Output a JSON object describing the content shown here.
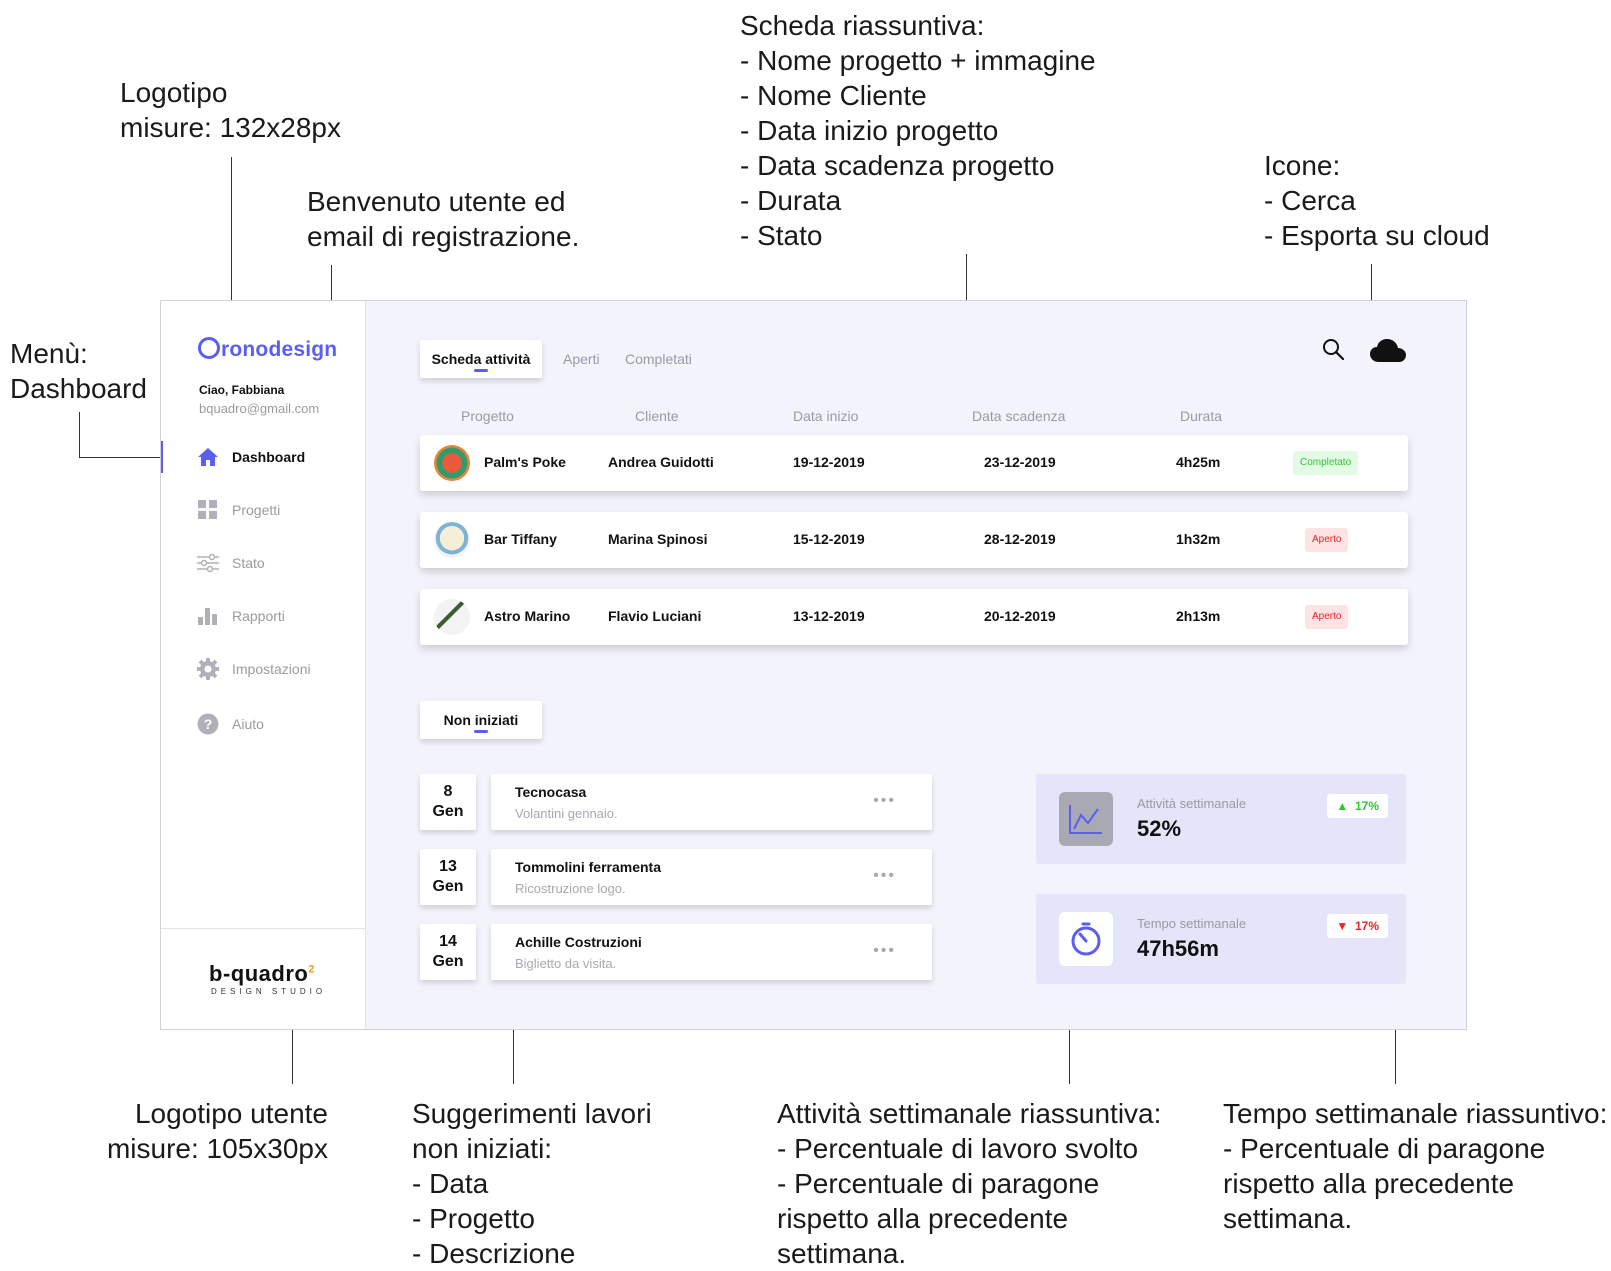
{
  "annotations": {
    "logo": "Logotipo\nmisure: 132x28px",
    "welcome": "Benvenuto utente ed\nemail di registrazione.",
    "summary": "Scheda riassuntiva:\n- Nome progetto + immagine\n- Nome Cliente\n- Data inizio progetto\n- Data scadenza progetto\n- Durata\n- Stato",
    "icons": "Icone:\n- Cerca\n- Esporta su cloud",
    "menu": "Menù:\nDashboard",
    "user_logo": "Logotipo utente\nmisure: 105x30px",
    "suggestions": "Suggerimenti lavori\nnon iniziati:\n- Data\n- Progetto\n- Descrizione",
    "weekly_activity": "Attività settimanale riassuntiva:\n- Percentuale di lavoro svolto\n- Percentuale di paragone\nrispetto alla precedente\nsettimana.",
    "weekly_time": "Tempo settimanale riassuntivo:\n- Percentuale di paragone\nrispetto alla precedente\nsettimana."
  },
  "sidebar": {
    "logo": "ronodesign",
    "greeting": "Ciao, Fabbiana",
    "email": "bquadro@gmail.com",
    "items": [
      {
        "label": "Dashboard",
        "icon": "home-icon"
      },
      {
        "label": "Progetti",
        "icon": "grid-icon"
      },
      {
        "label": "Stato",
        "icon": "sliders-icon"
      },
      {
        "label": "Rapporti",
        "icon": "bar-chart-icon"
      },
      {
        "label": "Impostazioni",
        "icon": "gear-icon"
      },
      {
        "label": "Aiuto",
        "icon": "help-icon"
      }
    ],
    "footer_logo": "b-quadro",
    "footer_sub": "DESIGN STUDIO"
  },
  "tabs": {
    "active": "Scheda attività",
    "open": "Aperti",
    "done": "Completati"
  },
  "table": {
    "headers": [
      "Progetto",
      "Cliente",
      "Data inizio",
      "Data scadenza",
      "Durata"
    ],
    "rows": [
      {
        "project": "Palm's Poke",
        "client": "Andrea Guidotti",
        "start": "19-12-2019",
        "end": "23-12-2019",
        "duration": "4h25m",
        "status": "Completato"
      },
      {
        "project": "Bar Tiffany",
        "client": "Marina Spinosi",
        "start": "15-12-2019",
        "end": "28-12-2019",
        "duration": "1h32m",
        "status": "Aperto"
      },
      {
        "project": "Astro Marino",
        "client": "Flavio Luciani",
        "start": "13-12-2019",
        "end": "20-12-2019",
        "duration": "2h13m",
        "status": "Aperto"
      }
    ]
  },
  "not_started": {
    "tab": "Non iniziati",
    "items": [
      {
        "day": "8",
        "month": "Gen",
        "title": "Tecnocasa",
        "desc": "Volantini gennaio."
      },
      {
        "day": "13",
        "month": "Gen",
        "title": "Tommolini ferramenta",
        "desc": "Ricostruzione logo."
      },
      {
        "day": "14",
        "month": "Gen",
        "title": "Achille Costruzioni",
        "desc": "Biglietto da visita."
      }
    ]
  },
  "stats": {
    "activity": {
      "label": "Attività settimanale",
      "value": "52%",
      "change": "17%",
      "trend": "up"
    },
    "time": {
      "label": "Tempo settimanale",
      "value": "47h56m",
      "change": "17%",
      "trend": "down"
    }
  },
  "colors": {
    "accent": "#5b5ff0",
    "up": "#2ec52e",
    "down": "#e8232a"
  }
}
